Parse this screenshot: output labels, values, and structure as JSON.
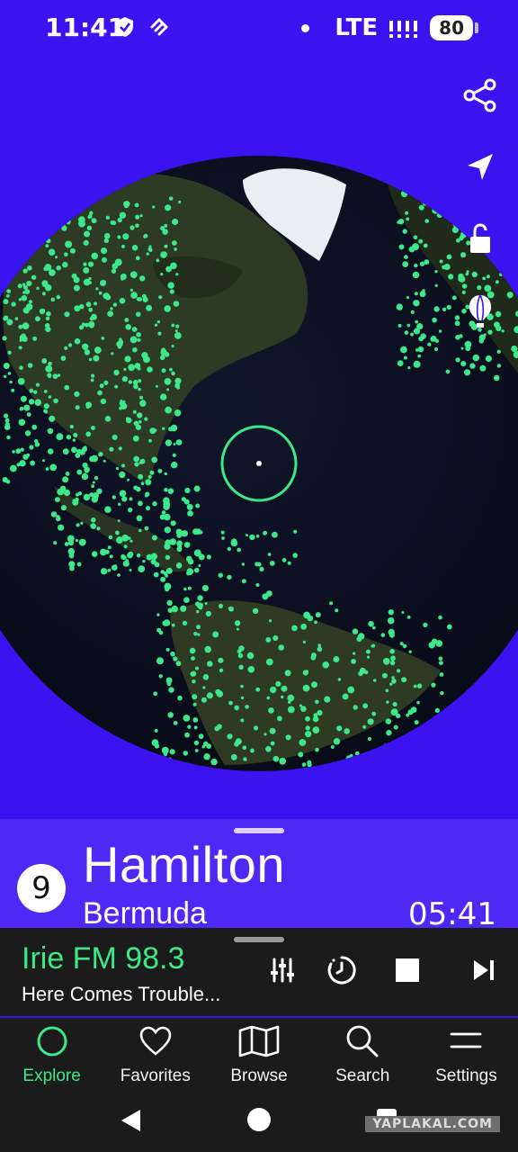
{
  "status": {
    "time": "11:41",
    "network": "LTE",
    "battery": "80"
  },
  "map_tools": [
    "share-icon",
    "locate-icon",
    "unlock-icon",
    "balloon-icon"
  ],
  "location": {
    "count": "9",
    "city": "Hamilton",
    "country": "Bermuda",
    "local_time": "05:41"
  },
  "player": {
    "station": "Irie FM 98.3",
    "track": "Here Comes Trouble..."
  },
  "nav": {
    "explore": "Explore",
    "favorites": "Favorites",
    "browse": "Browse",
    "search": "Search",
    "settings": "Settings"
  },
  "colors": {
    "background": "#3a13f0",
    "accent": "#3ce88a",
    "panel": "#1b1b1b"
  },
  "watermark": "YAPLAKAL.COM"
}
